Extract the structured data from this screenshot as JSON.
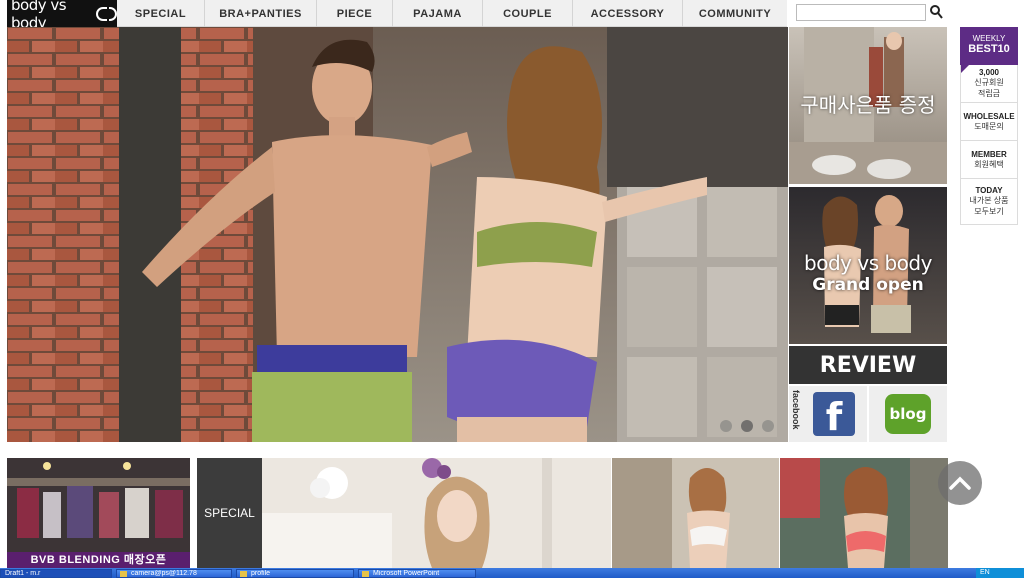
{
  "logo": {
    "text": "body vs body"
  },
  "nav": {
    "items": [
      "SPECIAL",
      "BRA+PANTIES",
      "PIECE",
      "PAJAMA",
      "COUPLE",
      "ACCESSORY",
      "COMMUNITY"
    ]
  },
  "search": {
    "value": "",
    "placeholder": ""
  },
  "hero": {
    "slides": 3,
    "active_slide": 1
  },
  "banners": {
    "gift_text": "구매사은품 증정",
    "open_brand": "body vs body",
    "open_text": "Grand open",
    "review": "REVIEW",
    "facebook_side": "facebook",
    "facebook_letter": "f",
    "blog": "blog"
  },
  "side": {
    "best_line1": "WEEKLY",
    "best_line2": "BEST10",
    "items": [
      {
        "t1": "3,000",
        "t2": "신규회원",
        "t3": "적립금"
      },
      {
        "t1": "WHOLESALE",
        "t2": "도매문의"
      },
      {
        "t1": "MEMBER",
        "t2": "회원혜택"
      },
      {
        "t1": "TODAY",
        "t2": "내가본 상품",
        "t3": "모두보기"
      }
    ]
  },
  "bottom": {
    "store_label": "BVB BLENDING 매장오픈",
    "special": "SPECIAL"
  },
  "taskbar": {
    "items": [
      "Draft1 - m.r",
      "camera@ps@112.78",
      "profile",
      "Microsoft PowerPoint"
    ],
    "tray": "EN"
  },
  "colors": {
    "accent_purple": "#5d2c85",
    "review_bg": "#333333",
    "facebook": "#3b5998",
    "blog": "#5ea22a"
  }
}
